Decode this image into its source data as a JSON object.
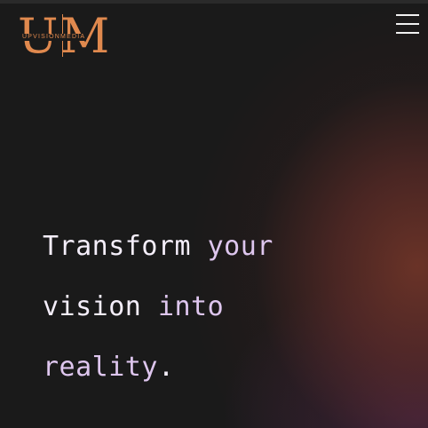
{
  "logo": {
    "letter_left": "U",
    "letter_right": "M",
    "wordmark": "UPVISIONMEDIA"
  },
  "header": {
    "menu_icon": "hamburger-menu-icon"
  },
  "hero": {
    "line1": {
      "word1": "Transform",
      "word2": "your"
    },
    "line2": {
      "word1": "vision",
      "word2": "into"
    },
    "line3": {
      "word1": "reality",
      "punct": "."
    }
  },
  "colors": {
    "accent": "#e0894e",
    "background": "#1a1a1a",
    "glow_orange": "#6e3428",
    "glow_purple": "#4e264e",
    "text_light": "#f4eefa",
    "text_lilac": "#dec6ee"
  }
}
